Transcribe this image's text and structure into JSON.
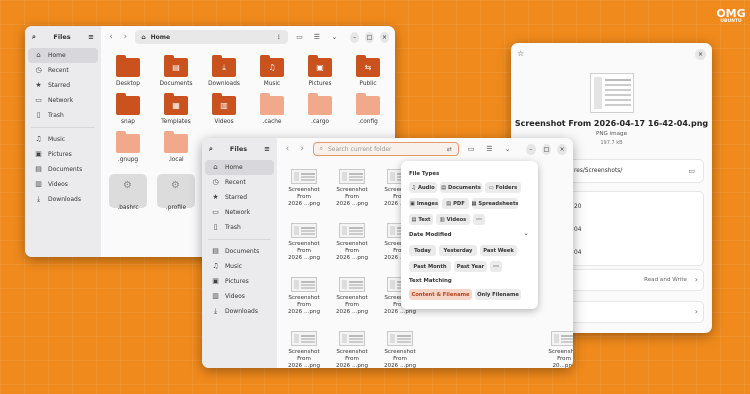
{
  "logo": {
    "line1": "OMG",
    "line2": "UBUNTU"
  },
  "back_window": {
    "title": "Files",
    "path": "Home",
    "sidebar": [
      {
        "label": "Home",
        "icon": "home-icon",
        "glyph": "⌂"
      },
      {
        "label": "Recent",
        "icon": "clock-icon",
        "glyph": "◷"
      },
      {
        "label": "Starred",
        "icon": "star-icon",
        "glyph": "★"
      },
      {
        "label": "Network",
        "icon": "network-icon",
        "glyph": "▭"
      },
      {
        "label": "Trash",
        "icon": "trash-icon",
        "glyph": "▯"
      },
      {
        "label": "Music",
        "icon": "music-icon",
        "glyph": "♫"
      },
      {
        "label": "Pictures",
        "icon": "pictures-icon",
        "glyph": "▣"
      },
      {
        "label": "Documents",
        "icon": "document-icon",
        "glyph": "▤"
      },
      {
        "label": "Videos",
        "icon": "video-icon",
        "glyph": "▥"
      },
      {
        "label": "Downloads",
        "icon": "download-icon",
        "glyph": "⤓"
      }
    ],
    "folders": [
      {
        "name": "Desktop",
        "style": "dark",
        "glyph": ""
      },
      {
        "name": "Documents",
        "style": "dark",
        "glyph": "▤"
      },
      {
        "name": "Downloads",
        "style": "dark",
        "glyph": "⤓"
      },
      {
        "name": "Music",
        "style": "dark",
        "glyph": "♫"
      },
      {
        "name": "Pictures",
        "style": "dark",
        "glyph": "▣"
      },
      {
        "name": "Public",
        "style": "dark",
        "glyph": "⇆"
      },
      {
        "name": "snap",
        "style": "dark",
        "glyph": ""
      },
      {
        "name": "Templates",
        "style": "dark",
        "glyph": "▦"
      },
      {
        "name": "Videos",
        "style": "dark",
        "glyph": "▥"
      },
      {
        "name": ".cache",
        "style": "light",
        "glyph": ""
      },
      {
        "name": ".cargo",
        "style": "light",
        "glyph": ""
      },
      {
        "name": ".config",
        "style": "light",
        "glyph": ""
      },
      {
        "name": ".gnupg",
        "style": "light",
        "glyph": ""
      },
      {
        "name": ".local",
        "style": "light",
        "glyph": ""
      }
    ],
    "files": [
      ".bashrc",
      ".profile"
    ]
  },
  "right_window": {
    "filename": "Screenshot From 2026-04-17 16-42-04.png",
    "type": "PNG image",
    "size": "197.7 kB",
    "folder_path": "res/Screenshots/",
    "dates": [
      "20",
      "04",
      "04"
    ],
    "permissions": "Read and Write"
  },
  "front_window": {
    "title": "Files",
    "search_placeholder": "Search current folder",
    "sidebar": [
      {
        "label": "Home",
        "icon": "home-icon",
        "glyph": "⌂"
      },
      {
        "label": "Recent",
        "icon": "clock-icon",
        "glyph": "◷"
      },
      {
        "label": "Starred",
        "icon": "star-icon",
        "glyph": "★"
      },
      {
        "label": "Network",
        "icon": "network-icon",
        "glyph": "▭"
      },
      {
        "label": "Trash",
        "icon": "trash-icon",
        "glyph": "▯"
      },
      {
        "label": "Documents",
        "icon": "document-icon",
        "glyph": "▤"
      },
      {
        "label": "Music",
        "icon": "music-icon",
        "glyph": "♫"
      },
      {
        "label": "Pictures",
        "icon": "pictures-icon",
        "glyph": "▣"
      },
      {
        "label": "Videos",
        "icon": "video-icon",
        "glyph": "▥"
      },
      {
        "label": "Downloads",
        "icon": "download-icon",
        "glyph": "⤓"
      }
    ],
    "thumb_line1": "Screenshot",
    "thumb_line2": "From",
    "thumb_line3": "2026 ...png",
    "right_thumb_line1": "Screenshot",
    "right_thumb_line2": "From",
    "right_thumb_line3": "20...png",
    "right_partial": [
      "shot",
      "creenshot",
      "rom",
      "..png"
    ],
    "search_popover": {
      "file_types_heading": "File Types",
      "file_types": [
        {
          "label": "Audio",
          "glyph": "♫"
        },
        {
          "label": "Documents",
          "glyph": "▤"
        },
        {
          "label": "Folders",
          "glyph": "▭"
        },
        {
          "label": "Images",
          "glyph": "▣"
        },
        {
          "label": "PDF",
          "glyph": "▤"
        },
        {
          "label": "Spreadsheets",
          "glyph": "▦"
        },
        {
          "label": "Text",
          "glyph": "▤"
        },
        {
          "label": "Videos",
          "glyph": "▥"
        },
        {
          "label": "···",
          "glyph": ""
        }
      ],
      "date_heading": "Date Modified",
      "date_chips": [
        "Today",
        "Yesterday",
        "Past Week",
        "Past Month",
        "Past Year",
        "···"
      ],
      "text_heading": "Text Matching",
      "text_chips": [
        {
          "label": "Content & Filename",
          "selected": true
        },
        {
          "label": "Only Filename",
          "selected": false
        }
      ]
    }
  },
  "colors": {
    "background": "#f08a1c",
    "folder_dark": "#c9521f",
    "folder_light": "#f1a98b",
    "accent_selected": "#b6401b"
  }
}
